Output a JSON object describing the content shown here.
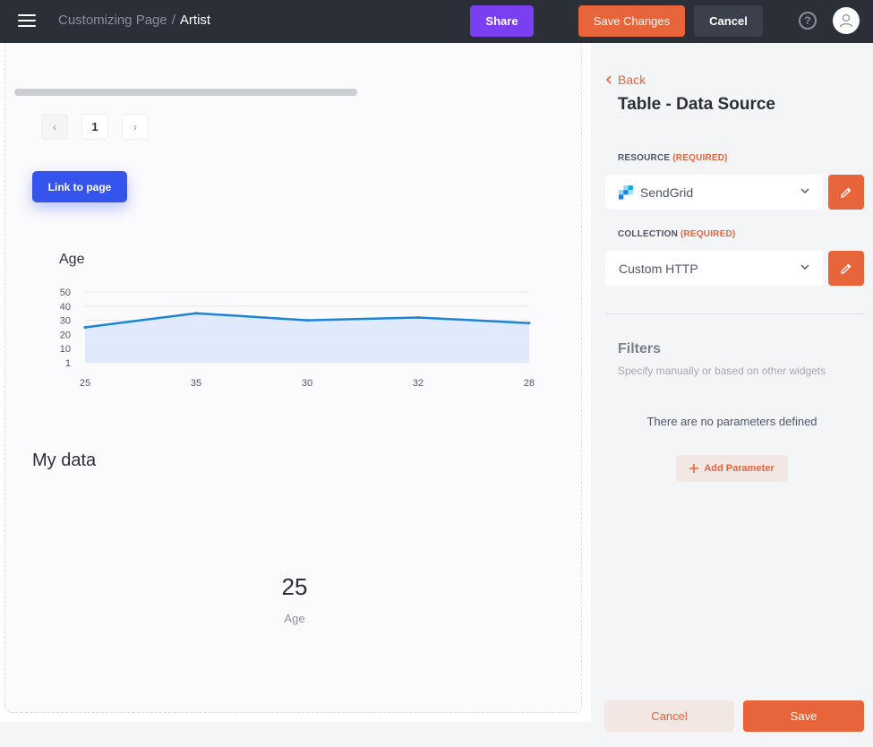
{
  "header": {
    "breadcrumb_parent": "Customizing Page",
    "breadcrumb_separator": "/",
    "breadcrumb_current": "Artist",
    "share_label": "Share",
    "save_changes_label": "Save Changes",
    "cancel_label": "Cancel",
    "help_icon": "question-circle-icon",
    "avatar_icon": "user-icon"
  },
  "canvas": {
    "pagination": {
      "prev": "‹",
      "page": "1",
      "next": "›"
    },
    "link_button_label": "Link to page",
    "chart_title": "Age",
    "section_title": "My data",
    "stat": {
      "value": "25",
      "label": "Age"
    }
  },
  "chart_data": {
    "type": "area",
    "title": "Age",
    "categories": [
      "25",
      "35",
      "30",
      "32",
      "28"
    ],
    "values": [
      25,
      35,
      30,
      32,
      28
    ],
    "y_ticks": [
      "50",
      "40",
      "30",
      "20",
      "10",
      "1"
    ],
    "ylim": [
      0,
      50
    ],
    "grid": true,
    "line_color": "#1a84d6",
    "fill_color": "#dbe6fb"
  },
  "panel": {
    "back_label": "Back",
    "title": "Table - Data Source",
    "resource_label": "RESOURCE",
    "resource_required": "(REQUIRED)",
    "resource_value": "SendGrid",
    "collection_label": "COLLECTION",
    "collection_required": "(REQUIRED)",
    "collection_value": "Custom HTTP",
    "filters_title": "Filters",
    "filters_subtitle": "Specify manually or based on other widgets",
    "no_params": "There are no parameters defined",
    "add_parameter_label": "Add Parameter",
    "cancel_label": "Cancel",
    "save_label": "Save"
  },
  "colors": {
    "accent": "#e8643a",
    "share": "#7b3ff2",
    "link_button": "#3554ee",
    "topbar": "#2b2f38"
  }
}
